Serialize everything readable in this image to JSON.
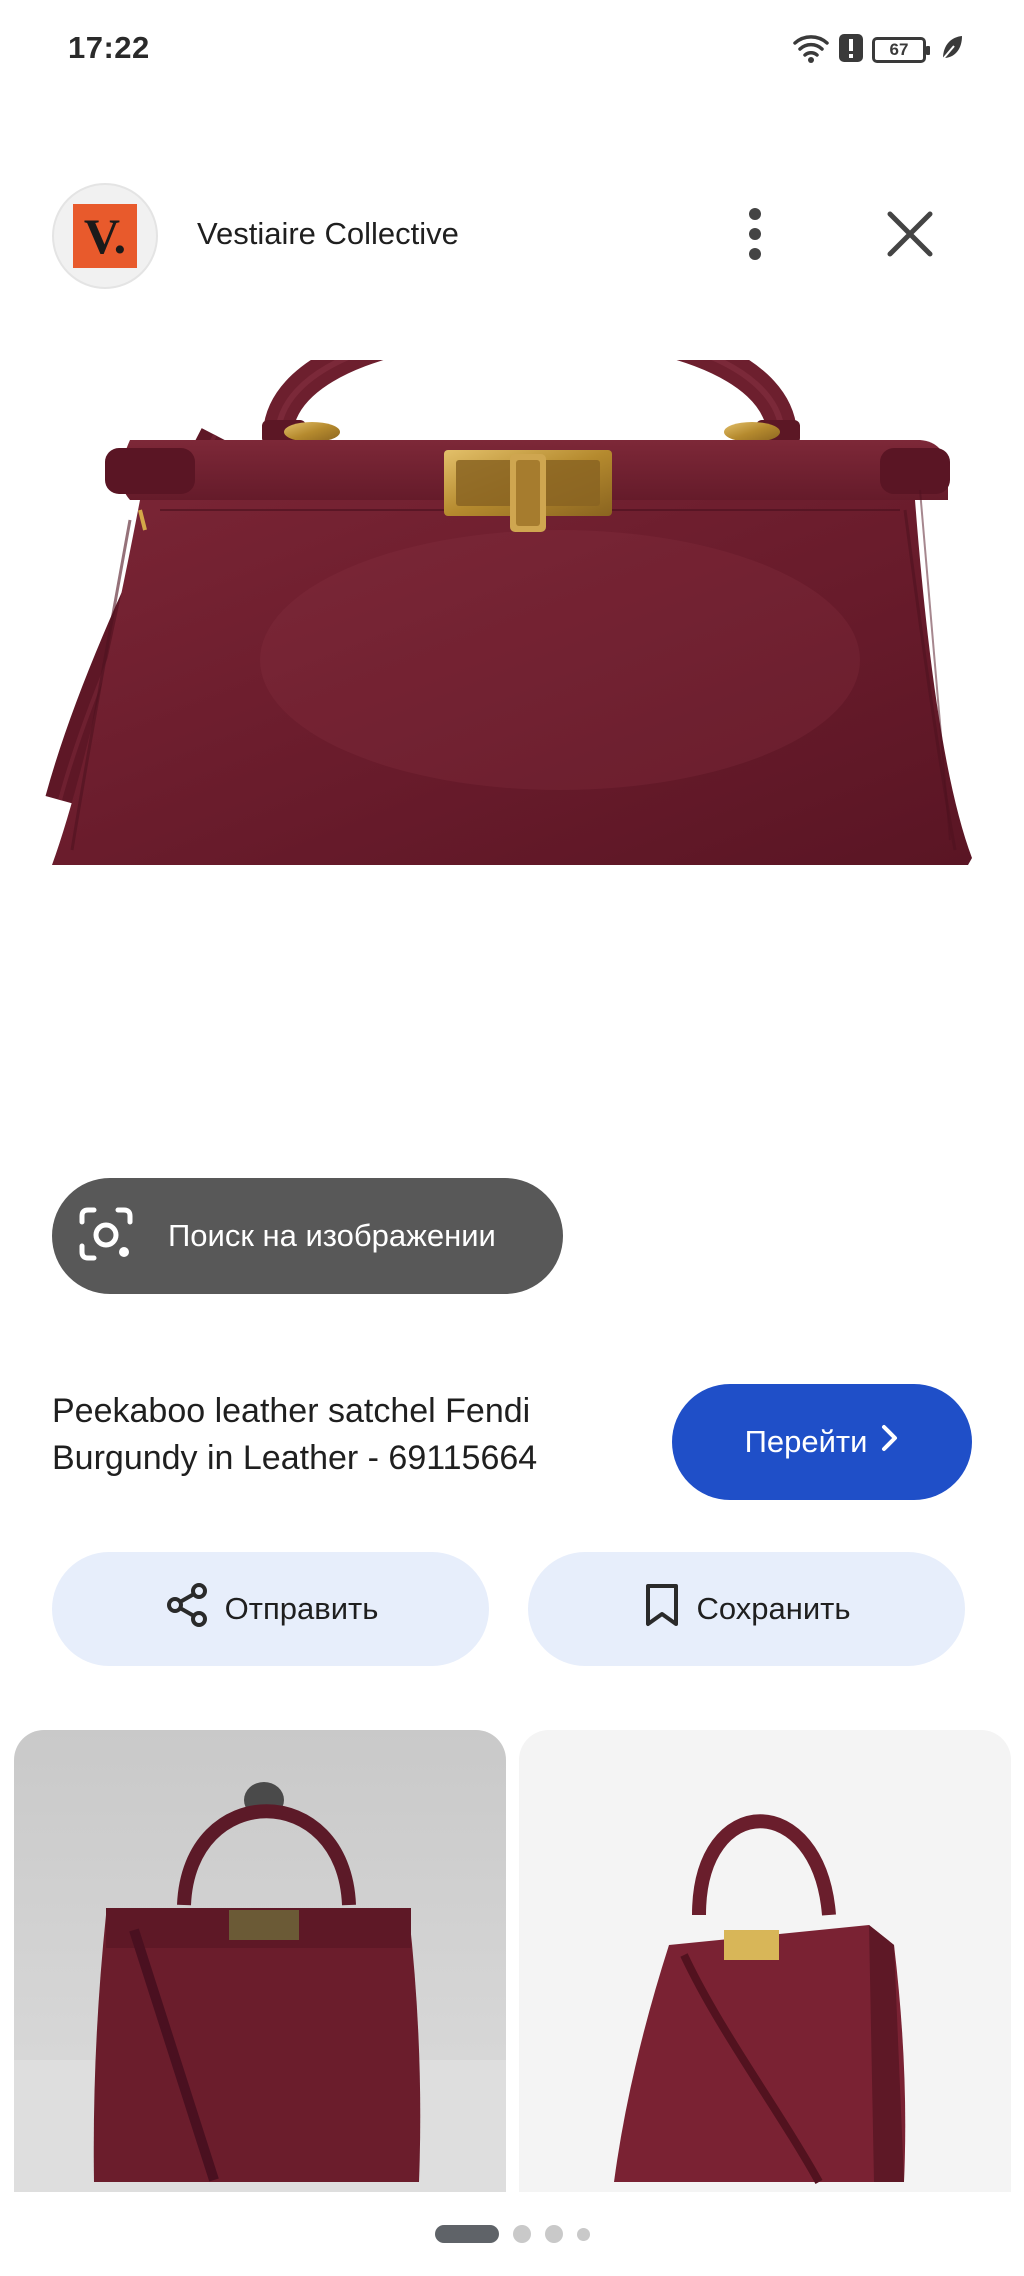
{
  "status_bar": {
    "time": "17:22",
    "battery": "67",
    "icons": [
      "wifi-icon",
      "alert-icon",
      "battery-icon",
      "leaf-icon"
    ]
  },
  "header": {
    "source_logo_text": "V.",
    "source_name": "Vestiaire Collective",
    "icons": [
      "more-vert-icon",
      "close-icon"
    ]
  },
  "lens": {
    "label": "Поиск на изображении",
    "icon": "lens-camera-icon"
  },
  "product": {
    "title": "Peekaboo leather satchel Fendi Burgundy in Leather - 69115664",
    "visit_label": "Перейти",
    "visit_icon": "chevron-right-icon"
  },
  "actions": {
    "share_label": "Отправить",
    "share_icon": "share-icon",
    "save_label": "Сохранить",
    "save_icon": "bookmark-icon"
  },
  "colors": {
    "accent_blue": "#1f4fc8",
    "tonal_button": "#e7eefb",
    "bag_burgundy": "#6e1f2e",
    "logo_orange": "#e85a2c"
  },
  "pager": {
    "count": 4,
    "active_index": 0
  }
}
